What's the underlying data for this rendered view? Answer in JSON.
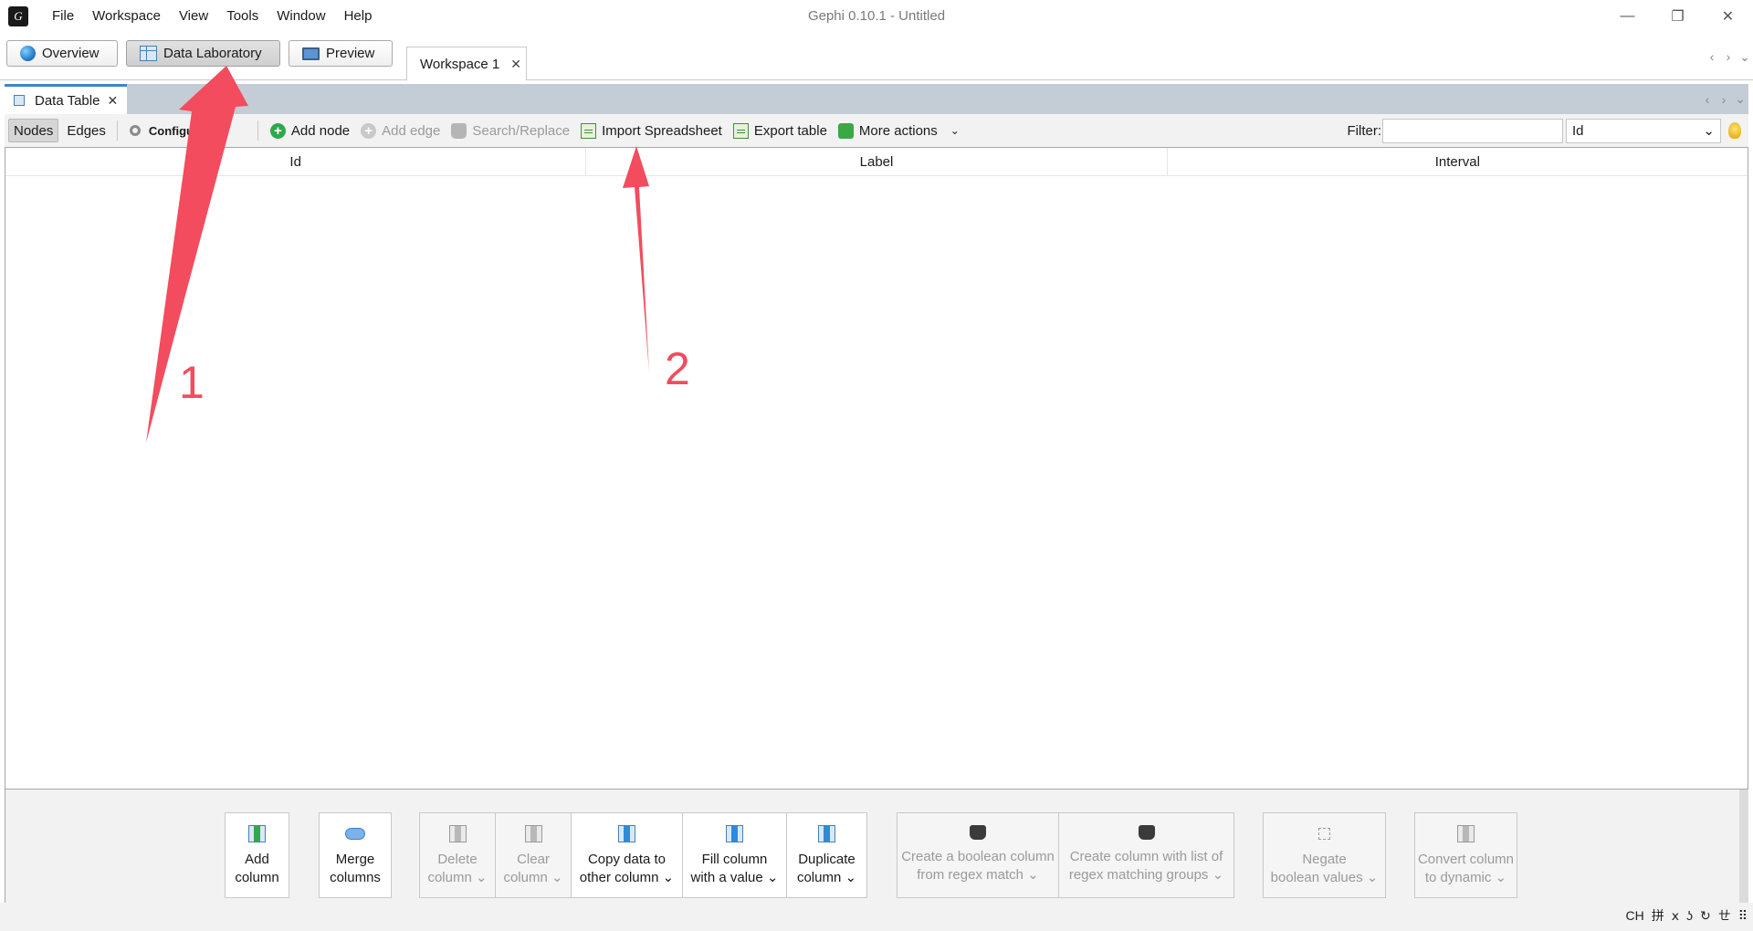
{
  "app": {
    "window_title": "Gephi 0.10.1 - Untitled",
    "menu": [
      "File",
      "Workspace",
      "View",
      "Tools",
      "Window",
      "Help"
    ],
    "window_controls": {
      "minimize": "—",
      "restore": "❐",
      "close": "✕"
    }
  },
  "perspectives": {
    "overview": "Overview",
    "data_laboratory": "Data Laboratory",
    "preview": "Preview",
    "active": "Data Laboratory"
  },
  "workspace_tab": {
    "label": "Workspace 1",
    "close": "✕"
  },
  "nav_arrows": {
    "left": "‹",
    "right": "›",
    "menu": "⌄"
  },
  "panel": {
    "tab_label": "Data Table",
    "close": "✕"
  },
  "toolbar": {
    "nodes": "Nodes",
    "edges": "Edges",
    "configuration": "Configuration",
    "add_node": "Add node",
    "add_edge": "Add edge",
    "search_replace": "Search/Replace",
    "import_spreadsheet": "Import Spreadsheet",
    "export_table": "Export table",
    "more_actions": "More actions",
    "more_caret": "⌄",
    "filter_label": "Filter:",
    "filter_value": "",
    "filter_column": "Id",
    "filter_caret": "⌄"
  },
  "table": {
    "columns": [
      "Id",
      "Label",
      "Interval"
    ],
    "rows": []
  },
  "column_actions": {
    "add_column": [
      "Add",
      "column"
    ],
    "merge_columns": [
      "Merge",
      "columns"
    ],
    "delete_column": [
      "Delete",
      "column ⌄"
    ],
    "clear_column": [
      "Clear",
      "column ⌄"
    ],
    "copy_data": [
      "Copy data to",
      "other column ⌄"
    ],
    "fill_column": [
      "Fill column",
      "with a value ⌄"
    ],
    "duplicate_column": [
      "Duplicate",
      "column ⌄"
    ],
    "boolean_regex": [
      "Create a boolean column",
      "from regex match ⌄"
    ],
    "regex_groups": [
      "Create column with list of",
      "regex matching groups ⌄"
    ],
    "negate_boolean": [
      "Negate",
      "boolean values ⌄"
    ],
    "convert_dynamic": [
      "Convert column",
      "to dynamic ⌄"
    ]
  },
  "statusbar": {
    "ime": [
      "CH",
      "拼",
      "ⅹ",
      "ʖ",
      "↻",
      "ㄝ",
      "⠿"
    ]
  },
  "annotations": {
    "arrow1_label": "1",
    "arrow2_label": "2",
    "color": "#f24c5e"
  }
}
